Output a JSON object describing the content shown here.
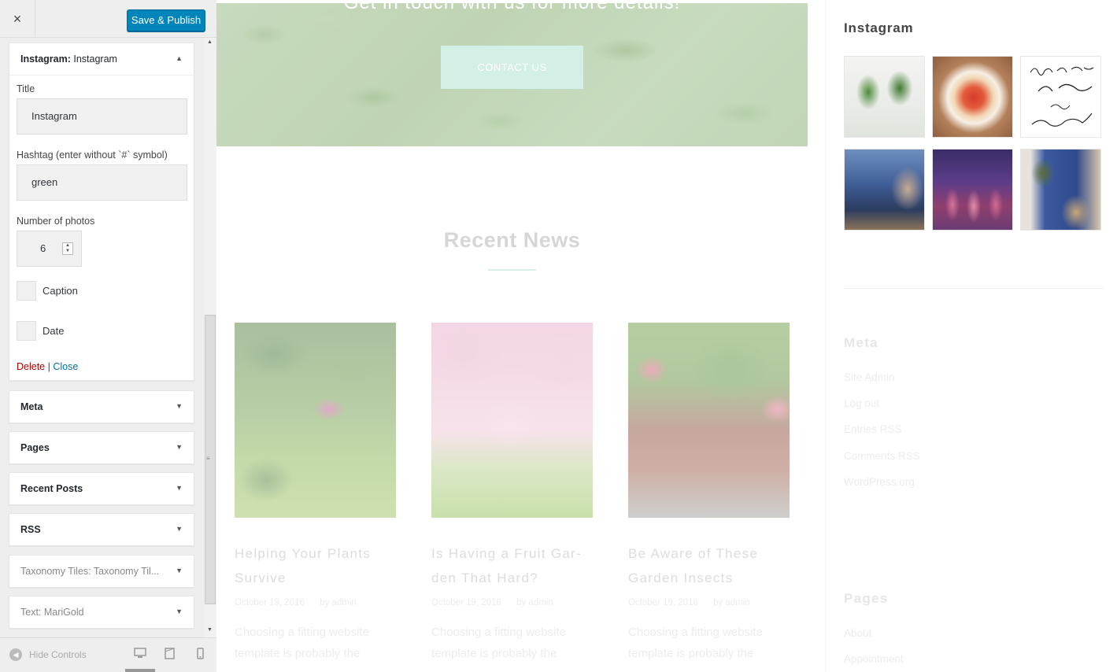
{
  "customizer": {
    "close_icon": "×",
    "save_label": "Save & Publish",
    "active_widget": {
      "title_bold": "Instagram:",
      "title_sub": " Instagram",
      "fields": {
        "title_label": "Title",
        "title_value": "Instagram",
        "hashtag_label": "Hashtag (enter without `#` symbol)",
        "hashtag_value": "green",
        "count_label": "Number of photos",
        "count_value": "6",
        "caption_label": "Caption",
        "date_label": "Date"
      },
      "delete_label": "Delete",
      "separator": "|",
      "close_label": "Close"
    },
    "widgets": [
      {
        "bold": "Meta",
        "sub": ""
      },
      {
        "bold": "Pages",
        "sub": ""
      },
      {
        "bold": "Recent Posts",
        "sub": ""
      },
      {
        "bold": "RSS",
        "sub": ""
      },
      {
        "bold": "Taxonomy Tiles:",
        "sub": " Taxonomy Til..."
      },
      {
        "bold": "Text:",
        "sub": " MariGold"
      }
    ],
    "footer": {
      "hide_label": "Hide Controls"
    }
  },
  "preview": {
    "hero_title": "Get in touch with us for more details!",
    "hero_button": "CONTACT US",
    "news_title": "Recent News",
    "posts": [
      {
        "title": "Helping Your Plants Survive",
        "date": "October 19, 2016",
        "author": "by admin",
        "excerpt": "Choosing a fitting website template is probably the"
      },
      {
        "title": "Is Having a Fruit Gar-den That Hard?",
        "date": "October 19, 2016",
        "author": "by admin",
        "excerpt": "Choosing a fitting website template is probably the"
      },
      {
        "title": "Be Aware of These Garden Insects",
        "date": "October 19, 2016",
        "author": "by admin",
        "excerpt": "Choosing a fitting website template is probably the"
      }
    ],
    "sidebar": {
      "instagram_title": "Instagram",
      "meta_title": "Meta",
      "meta_links": [
        "Site Admin",
        "Log out",
        "Entries RSS",
        "Comments RSS",
        "WordPress.org"
      ],
      "pages_title": "Pages",
      "pages_links": [
        "About",
        "Appointment"
      ]
    }
  }
}
